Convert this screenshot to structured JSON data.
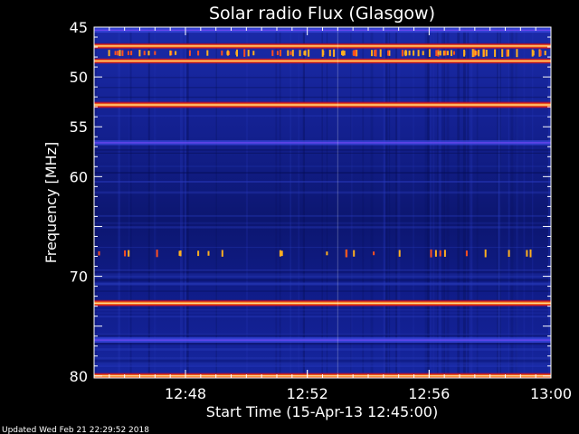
{
  "chart_data": {
    "type": "heatmap",
    "title": "Solar radio Flux (Glasgow)",
    "xlabel": "Start Time (15-Apr-13 12:45:00)",
    "ylabel": "Frequency [MHz]",
    "footer": "Updated Wed Feb 21 22:29:52 2018",
    "xlim": [
      "12:45",
      "13:00"
    ],
    "ylim": [
      45,
      80.2
    ],
    "y_inverted": true,
    "x_ticks": [
      "12:48",
      "12:52",
      "12:56",
      "13:00"
    ],
    "y_ticks": [
      45,
      50,
      55,
      60,
      70,
      80
    ],
    "colors": {
      "background": "#000000",
      "plot_base": "#101a8c",
      "band_core": "#fff5c0",
      "band_mid": "#ff7a10",
      "band_edge": "#c01030",
      "text": "#ffffff"
    },
    "bands": [
      {
        "freq": 45.3,
        "intensity": 0.5
      },
      {
        "freq": 46.9,
        "intensity": 0.8
      },
      {
        "freq": 48.4,
        "intensity": 0.7
      },
      {
        "freq": 52.8,
        "intensity": 1.0
      },
      {
        "freq": 56.6,
        "intensity": 0.45
      },
      {
        "freq": 72.7,
        "intensity": 1.0
      },
      {
        "freq": 76.4,
        "intensity": 0.55
      },
      {
        "freq": 80.0,
        "intensity": 0.9
      }
    ],
    "spike_bands": [
      {
        "freq": 47.6,
        "density": 0.55
      },
      {
        "freq": 67.7,
        "density": 0.15
      }
    ],
    "burst_time": "12:53"
  }
}
